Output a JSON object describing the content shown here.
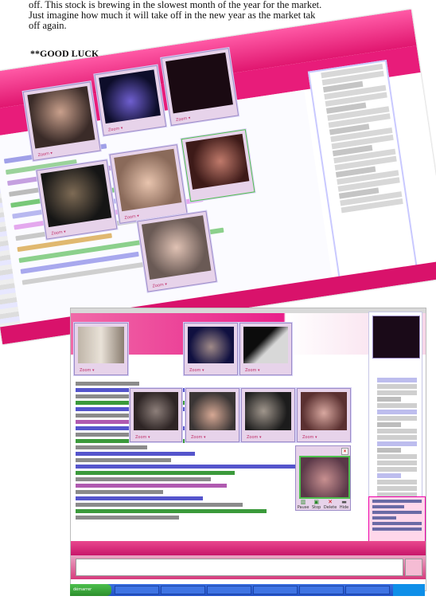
{
  "article": {
    "line1": "off. This stock is brewing in the slowest month of the year for the market.",
    "line2": "Just imagine how much it will take off in the new year as the market tak",
    "line3": "off again.",
    "closing": "**GOOD LUCK"
  },
  "cam_window": {
    "zoom_label": "Zoom ▾",
    "close_icon": "close-icon"
  },
  "popup_toolbar": {
    "buttons": [
      {
        "label": "Pause",
        "icon": "pause-icon"
      },
      {
        "label": "Stop",
        "icon": "stop-icon"
      },
      {
        "label": "Delete",
        "icon": "delete-icon"
      },
      {
        "label": "Hide",
        "icon": "hide-icon"
      }
    ]
  },
  "taskbar": {
    "start_label": "démarrer"
  },
  "colors": {
    "brand_pink": "#e81c7a",
    "cam_frame": "#e7d3ea",
    "taskbar_blue": "#2251c8"
  }
}
